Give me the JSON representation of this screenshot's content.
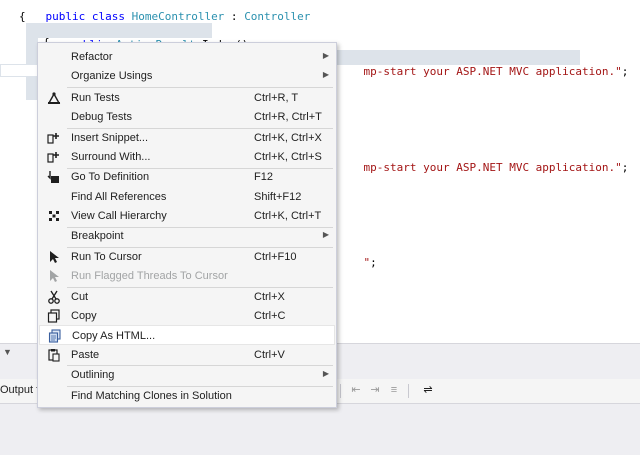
{
  "editor": {
    "lines": {
      "l1": {
        "kw": "public class ",
        "type": "HomeController",
        "plain": " : ",
        "type2": "Controller"
      },
      "l2": "{",
      "l3": {
        "kw": "public ",
        "type": "ActionResult",
        "plain": " Index()"
      },
      "l4": "{",
      "l5": {
        "str": "mp-start your ASP.NET MVC application.\"",
        "plain": ";"
      },
      "l6": {
        "str": "mp-start your ASP.NET MVC application.\"",
        "plain": ";"
      },
      "l7": {
        "str": "\"",
        "plain": ";"
      }
    }
  },
  "output": {
    "label": "Output fro"
  },
  "context_menu": {
    "items": [
      {
        "label": "Refactor",
        "submenu": true
      },
      {
        "label": "Organize Usings",
        "submenu": true
      },
      {
        "label": "Run Tests",
        "shortcut": "Ctrl+R, T",
        "icon": "run-tests-icon"
      },
      {
        "label": "Debug Tests",
        "shortcut": "Ctrl+R, Ctrl+T"
      },
      {
        "label": "Insert Snippet...",
        "shortcut": "Ctrl+K, Ctrl+X",
        "icon": "insert-snippet-icon"
      },
      {
        "label": "Surround With...",
        "shortcut": "Ctrl+K, Ctrl+S",
        "icon": "surround-with-icon"
      },
      {
        "label": "Go To Definition",
        "shortcut": "F12",
        "icon": "go-to-definition-icon"
      },
      {
        "label": "Find All References",
        "shortcut": "Shift+F12"
      },
      {
        "label": "View Call Hierarchy",
        "shortcut": "Ctrl+K, Ctrl+T",
        "icon": "call-hierarchy-icon"
      },
      {
        "label": "Breakpoint",
        "submenu": true
      },
      {
        "label": "Run To Cursor",
        "shortcut": "Ctrl+F10",
        "icon": "cursor-arrow-icon"
      },
      {
        "label": "Run Flagged Threads To Cursor",
        "icon": "cursor-arrow-icon",
        "disabled": true
      },
      {
        "label": "Cut",
        "shortcut": "Ctrl+X",
        "icon": "scissors-icon"
      },
      {
        "label": "Copy",
        "shortcut": "Ctrl+C",
        "icon": "copy-icon"
      },
      {
        "label": "Copy As HTML...",
        "icon": "copy-html-icon",
        "highlighted": true
      },
      {
        "label": "Paste",
        "shortcut": "Ctrl+V",
        "icon": "paste-icon"
      },
      {
        "label": "Outlining",
        "submenu": true
      },
      {
        "label": "Find Matching Clones in Solution"
      }
    ]
  },
  "colors": {
    "keyword": "#0000ff",
    "type": "#2b91af",
    "string": "#a31515",
    "menu_background": "#f5f5f5",
    "menu_highlight": "#ffffff"
  }
}
